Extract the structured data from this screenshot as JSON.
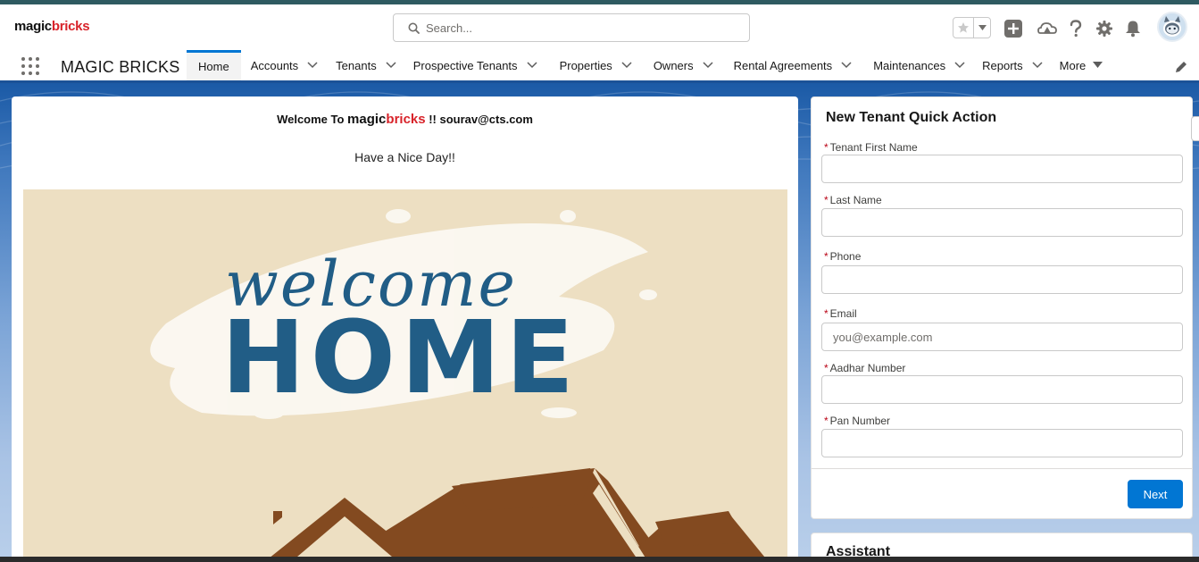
{
  "logo": {
    "part1": "magic",
    "part2": "bricks"
  },
  "search": {
    "placeholder": "Search..."
  },
  "header_icons": [
    "star-icon",
    "chevron-down-icon",
    "plus-icon",
    "cloud-trailhead-icon",
    "help-icon",
    "gear-icon",
    "bell-icon",
    "avatar"
  ],
  "nav": {
    "app_name": "MAGIC BRICKS",
    "tabs": [
      {
        "label": "Home",
        "active": true
      },
      {
        "label": "Accounts"
      },
      {
        "label": "Tenants"
      },
      {
        "label": "Prospective Tenants"
      },
      {
        "label": "Properties"
      },
      {
        "label": "Owners"
      },
      {
        "label": "Rental Agreements"
      },
      {
        "label": "Maintenances"
      },
      {
        "label": "Reports"
      },
      {
        "label": "More"
      }
    ]
  },
  "welcome": {
    "prefix": "Welcome To ",
    "brand1": "magic",
    "brand2": "bricks",
    "suffix": " !! sourav@cts.com",
    "subtitle": "Have a Nice Day!!"
  },
  "hero": {
    "script_text": "welcome",
    "big_text": "HOME"
  },
  "quick_action": {
    "title": "New Tenant Quick Action",
    "fields": [
      {
        "label": "Tenant First Name",
        "value": "",
        "placeholder": ""
      },
      {
        "label": "Last Name",
        "value": "",
        "placeholder": ""
      },
      {
        "label": "Phone",
        "value": "",
        "placeholder": ""
      },
      {
        "label": "Email",
        "value": "",
        "placeholder": "you@example.com"
      },
      {
        "label": "Aadhar Number",
        "value": "",
        "placeholder": ""
      },
      {
        "label": "Pan Number",
        "value": "",
        "placeholder": ""
      }
    ],
    "next_label": "Next"
  },
  "assistant": {
    "title": "Assistant"
  },
  "colors": {
    "brand_red": "#d8232a",
    "primary_blue": "#0176d3",
    "hero_blue": "#215d86",
    "hero_brown": "#834a20",
    "hero_bg": "#eddfc2"
  }
}
